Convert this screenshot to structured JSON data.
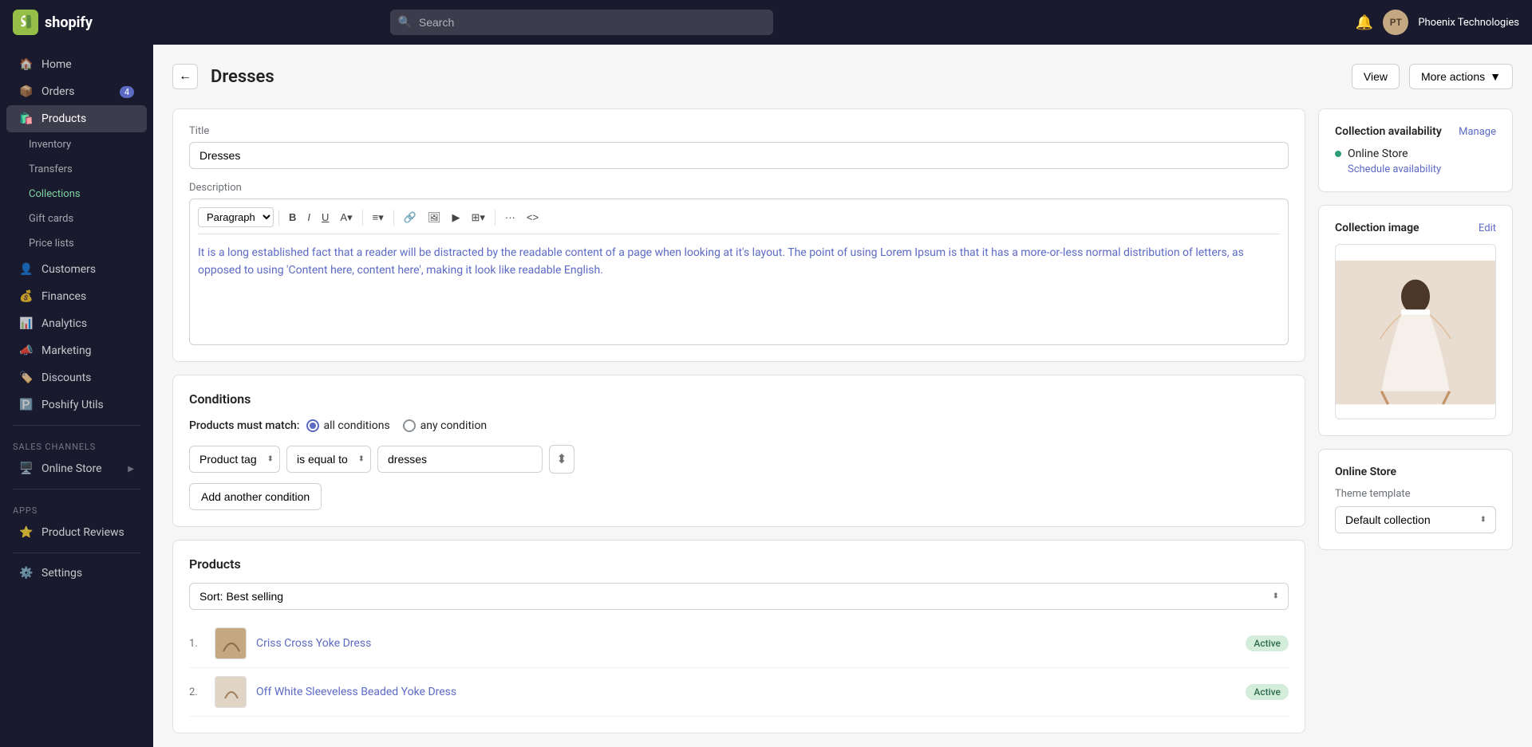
{
  "topbar": {
    "logo_text": "shopify",
    "search_placeholder": "Search",
    "bell_icon": "🔔",
    "avatar_initials": "PT",
    "store_name": "Phoenix Technologies"
  },
  "sidebar": {
    "items": [
      {
        "id": "home",
        "label": "Home",
        "icon": "🏠",
        "active": false,
        "sub": false
      },
      {
        "id": "orders",
        "label": "Orders",
        "icon": "📦",
        "active": false,
        "sub": false,
        "badge": "4"
      },
      {
        "id": "products",
        "label": "Products",
        "icon": "🛍️",
        "active": true,
        "sub": false
      },
      {
        "id": "inventory",
        "label": "Inventory",
        "icon": "",
        "active": false,
        "sub": true
      },
      {
        "id": "transfers",
        "label": "Transfers",
        "icon": "",
        "active": false,
        "sub": true
      },
      {
        "id": "collections",
        "label": "Collections",
        "icon": "",
        "active": true,
        "sub": true
      },
      {
        "id": "gift_cards",
        "label": "Gift cards",
        "icon": "",
        "active": false,
        "sub": true
      },
      {
        "id": "price_lists",
        "label": "Price lists",
        "icon": "",
        "active": false,
        "sub": true
      },
      {
        "id": "customers",
        "label": "Customers",
        "icon": "👤",
        "active": false,
        "sub": false
      },
      {
        "id": "finances",
        "label": "Finances",
        "icon": "💰",
        "active": false,
        "sub": false
      },
      {
        "id": "analytics",
        "label": "Analytics",
        "icon": "📊",
        "active": false,
        "sub": false
      },
      {
        "id": "marketing",
        "label": "Marketing",
        "icon": "📣",
        "active": false,
        "sub": false
      },
      {
        "id": "discounts",
        "label": "Discounts",
        "icon": "🏷️",
        "active": false,
        "sub": false
      },
      {
        "id": "poshify_utils",
        "label": "Poshify Utils",
        "icon": "🅿️",
        "active": false,
        "sub": false
      }
    ],
    "sales_channels_label": "Sales channels",
    "online_store": "Online Store",
    "apps_label": "Apps",
    "product_reviews": "Product Reviews",
    "settings": "Settings"
  },
  "page": {
    "title": "Dresses",
    "back_label": "←",
    "view_label": "View",
    "more_actions_label": "More actions"
  },
  "title_section": {
    "label": "Title",
    "value": "Dresses"
  },
  "description_section": {
    "label": "Description",
    "paragraph_option": "Paragraph",
    "content": "It is a long established fact that a reader will be distracted by the readable content of a page when looking at it's layout. The point of using Lorem Ipsum is that it has a more-or-less normal distribution of letters, as opposed to using 'Content here, content here', making it look like readable English."
  },
  "conditions": {
    "section_title": "Conditions",
    "match_label": "Products must match:",
    "all_label": "all conditions",
    "any_label": "any condition",
    "selected": "all",
    "condition_field": "Product tag",
    "condition_operator": "is equal to",
    "condition_value": "dresses",
    "add_button": "Add another condition"
  },
  "products_section": {
    "title": "Products",
    "sort_label": "Sort:",
    "sort_value": "Best selling",
    "items": [
      {
        "num": "1.",
        "name": "Criss Cross Yoke Dress",
        "status": "Active",
        "thumb_color": "#c4a882"
      },
      {
        "num": "2.",
        "name": "Off White Sleeveless Beaded Yoke Dress",
        "status": "Active",
        "thumb_color": "#e0d5c5"
      }
    ]
  },
  "collection_availability": {
    "title": "Collection availability",
    "manage_label": "Manage",
    "store_label": "Online Store",
    "schedule_label": "Schedule availability"
  },
  "collection_image": {
    "title": "Collection image",
    "edit_label": "Edit"
  },
  "online_store": {
    "title": "Online Store",
    "theme_label": "Theme template",
    "theme_value": "Default collection"
  },
  "toolbar": {
    "bold": "B",
    "italic": "I",
    "underline": "U",
    "link": "🔗",
    "image": "🖼",
    "video": "▶",
    "table": "⊞",
    "more": "···",
    "source": "<>"
  }
}
